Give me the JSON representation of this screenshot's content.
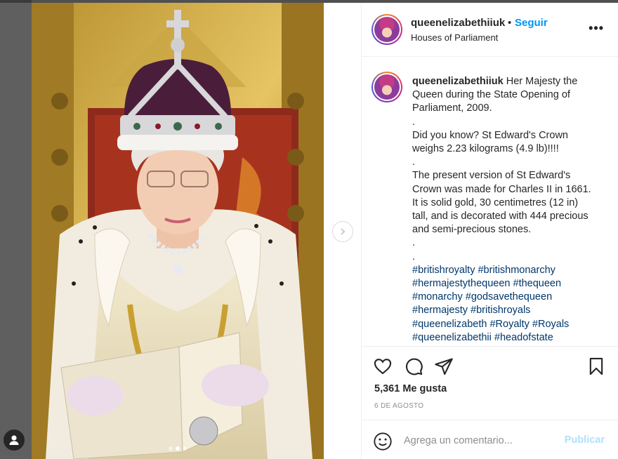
{
  "post": {
    "username": "queenelizabethiiuk",
    "separator": "•",
    "follow_label": "Seguir",
    "location": "Houses of Parliament",
    "more_label": "•••"
  },
  "caption": {
    "username": "queenelizabethiiuk",
    "line1": "Her Majesty the Queen during the State Opening of Parliament, 2009.",
    "dot1": ".",
    "line2": "Did you know? St Edward's Crown weighs 2.23 kilograms (4.9 lb)!!!!",
    "dot2": ".",
    "line3": "The present version of St Edward's Crown was made for Charles II in 1661. It is solid gold, 30 centimetres (12 in) tall, and is decorated with 444 precious and semi-precious stones.",
    "dot3": ".",
    "dot4": ".",
    "hashtags": [
      "#britishroyalty",
      "#britishmonarchy",
      "#hermajestythequeen",
      "#thequeen",
      "#monarchy",
      "#godsavethequeen",
      "#hermajesty",
      "#britishroyals",
      "#queenelizabeth",
      "#Royalty",
      "#Royals",
      "#queenelizabethii",
      "#headofstate"
    ]
  },
  "engagement": {
    "likes": "5,361 Me gusta",
    "date": "6 DE AGOSTO"
  },
  "comment": {
    "placeholder": "Agrega un comentario...",
    "publish_label": "Publicar"
  },
  "carousel": {
    "total": 3,
    "active_index": 1
  },
  "colors": {
    "accent": "#0095f6",
    "hashtag": "#00376b",
    "publish_disabled": "#b2dffc"
  }
}
